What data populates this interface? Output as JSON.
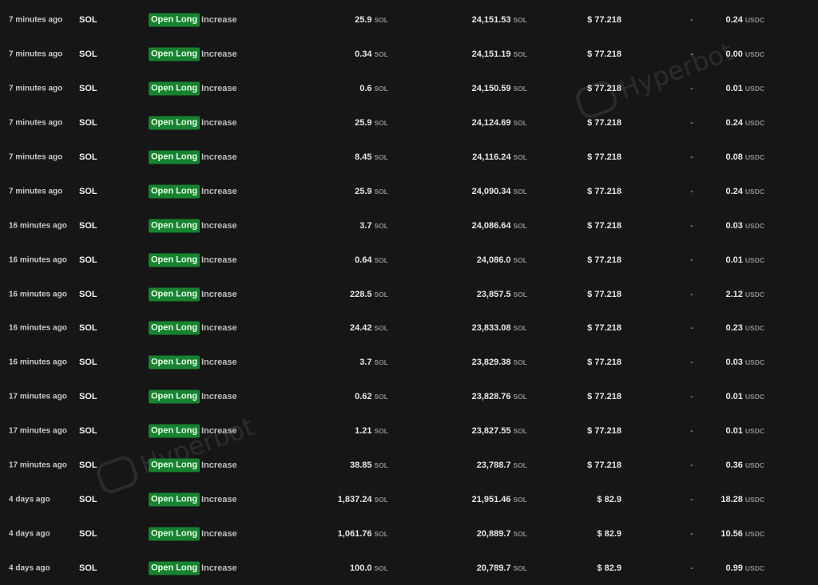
{
  "watermark": "Hyperbot",
  "badge_color": "#17822f",
  "rows": [
    {
      "time": "7 minutes ago",
      "coin": "SOL",
      "badge": "Open Long",
      "action": "Increase",
      "size": "25.9",
      "size_unit": "SOL",
      "position": "24,151.53",
      "position_unit": "SOL",
      "price": "$ 77.218",
      "pnl": "-",
      "fee": "0.24",
      "fee_unit": "USDC"
    },
    {
      "time": "7 minutes ago",
      "coin": "SOL",
      "badge": "Open Long",
      "action": "Increase",
      "size": "0.34",
      "size_unit": "SOL",
      "position": "24,151.19",
      "position_unit": "SOL",
      "price": "$ 77.218",
      "pnl": "-",
      "fee": "0.00",
      "fee_unit": "USDC"
    },
    {
      "time": "7 minutes ago",
      "coin": "SOL",
      "badge": "Open Long",
      "action": "Increase",
      "size": "0.6",
      "size_unit": "SOL",
      "position": "24,150.59",
      "position_unit": "SOL",
      "price": "$ 77.218",
      "pnl": "-",
      "fee": "0.01",
      "fee_unit": "USDC"
    },
    {
      "time": "7 minutes ago",
      "coin": "SOL",
      "badge": "Open Long",
      "action": "Increase",
      "size": "25.9",
      "size_unit": "SOL",
      "position": "24,124.69",
      "position_unit": "SOL",
      "price": "$ 77.218",
      "pnl": "-",
      "fee": "0.24",
      "fee_unit": "USDC"
    },
    {
      "time": "7 minutes ago",
      "coin": "SOL",
      "badge": "Open Long",
      "action": "Increase",
      "size": "8.45",
      "size_unit": "SOL",
      "position": "24,116.24",
      "position_unit": "SOL",
      "price": "$ 77.218",
      "pnl": "-",
      "fee": "0.08",
      "fee_unit": "USDC"
    },
    {
      "time": "7 minutes ago",
      "coin": "SOL",
      "badge": "Open Long",
      "action": "Increase",
      "size": "25.9",
      "size_unit": "SOL",
      "position": "24,090.34",
      "position_unit": "SOL",
      "price": "$ 77.218",
      "pnl": "-",
      "fee": "0.24",
      "fee_unit": "USDC"
    },
    {
      "time": "16 minutes ago",
      "coin": "SOL",
      "badge": "Open Long",
      "action": "Increase",
      "size": "3.7",
      "size_unit": "SOL",
      "position": "24,086.64",
      "position_unit": "SOL",
      "price": "$ 77.218",
      "pnl": "-",
      "fee": "0.03",
      "fee_unit": "USDC"
    },
    {
      "time": "16 minutes ago",
      "coin": "SOL",
      "badge": "Open Long",
      "action": "Increase",
      "size": "0.64",
      "size_unit": "SOL",
      "position": "24,086.0",
      "position_unit": "SOL",
      "price": "$ 77.218",
      "pnl": "-",
      "fee": "0.01",
      "fee_unit": "USDC"
    },
    {
      "time": "16 minutes ago",
      "coin": "SOL",
      "badge": "Open Long",
      "action": "Increase",
      "size": "228.5",
      "size_unit": "SOL",
      "position": "23,857.5",
      "position_unit": "SOL",
      "price": "$ 77.218",
      "pnl": "-",
      "fee": "2.12",
      "fee_unit": "USDC"
    },
    {
      "time": "16 minutes ago",
      "coin": "SOL",
      "badge": "Open Long",
      "action": "Increase",
      "size": "24.42",
      "size_unit": "SOL",
      "position": "23,833.08",
      "position_unit": "SOL",
      "price": "$ 77.218",
      "pnl": "-",
      "fee": "0.23",
      "fee_unit": "USDC"
    },
    {
      "time": "16 minutes ago",
      "coin": "SOL",
      "badge": "Open Long",
      "action": "Increase",
      "size": "3.7",
      "size_unit": "SOL",
      "position": "23,829.38",
      "position_unit": "SOL",
      "price": "$ 77.218",
      "pnl": "-",
      "fee": "0.03",
      "fee_unit": "USDC"
    },
    {
      "time": "17 minutes ago",
      "coin": "SOL",
      "badge": "Open Long",
      "action": "Increase",
      "size": "0.62",
      "size_unit": "SOL",
      "position": "23,828.76",
      "position_unit": "SOL",
      "price": "$ 77.218",
      "pnl": "-",
      "fee": "0.01",
      "fee_unit": "USDC"
    },
    {
      "time": "17 minutes ago",
      "coin": "SOL",
      "badge": "Open Long",
      "action": "Increase",
      "size": "1.21",
      "size_unit": "SOL",
      "position": "23,827.55",
      "position_unit": "SOL",
      "price": "$ 77.218",
      "pnl": "-",
      "fee": "0.01",
      "fee_unit": "USDC"
    },
    {
      "time": "17 minutes ago",
      "coin": "SOL",
      "badge": "Open Long",
      "action": "Increase",
      "size": "38.85",
      "size_unit": "SOL",
      "position": "23,788.7",
      "position_unit": "SOL",
      "price": "$ 77.218",
      "pnl": "-",
      "fee": "0.36",
      "fee_unit": "USDC"
    },
    {
      "time": "4 days ago",
      "coin": "SOL",
      "badge": "Open Long",
      "action": "Increase",
      "size": "1,837.24",
      "size_unit": "SOL",
      "position": "21,951.46",
      "position_unit": "SOL",
      "price": "$ 82.9",
      "pnl": "-",
      "fee": "18.28",
      "fee_unit": "USDC"
    },
    {
      "time": "4 days ago",
      "coin": "SOL",
      "badge": "Open Long",
      "action": "Increase",
      "size": "1,061.76",
      "size_unit": "SOL",
      "position": "20,889.7",
      "position_unit": "SOL",
      "price": "$ 82.9",
      "pnl": "-",
      "fee": "10.56",
      "fee_unit": "USDC"
    },
    {
      "time": "4 days ago",
      "coin": "SOL",
      "badge": "Open Long",
      "action": "Increase",
      "size": "100.0",
      "size_unit": "SOL",
      "position": "20,789.7",
      "position_unit": "SOL",
      "price": "$ 82.9",
      "pnl": "-",
      "fee": "0.99",
      "fee_unit": "USDC"
    }
  ]
}
